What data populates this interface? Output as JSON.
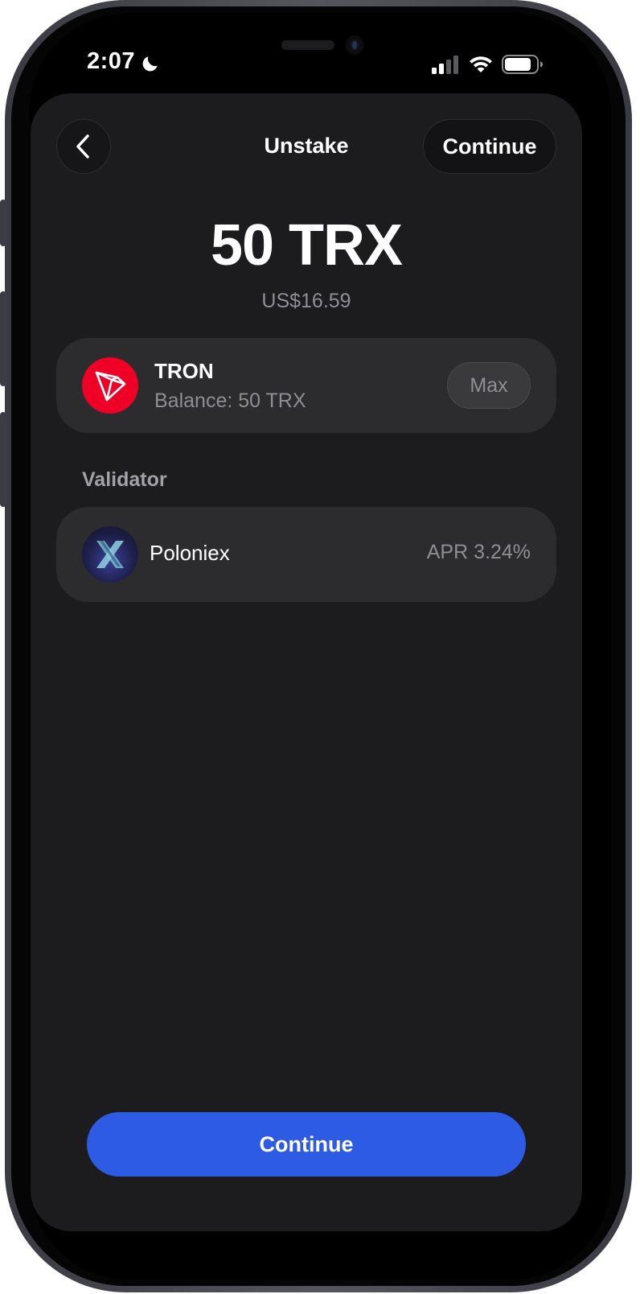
{
  "status_bar": {
    "time": "2:07",
    "icons": [
      "moon-icon",
      "cellular-signal-icon",
      "wifi-icon",
      "battery-icon"
    ]
  },
  "header": {
    "title": "Unstake",
    "back_icon": "chevron-left-icon",
    "continue_label": "Continue"
  },
  "amount": {
    "value": "50 TRX",
    "fiat": "US$16.59"
  },
  "token": {
    "icon": "tron-logo-icon",
    "name": "TRON",
    "balance": "Balance: 50 TRX",
    "max_label": "Max"
  },
  "validator": {
    "section_label": "Validator",
    "icon": "poloniex-logo-icon",
    "name": "Poloniex",
    "apr": "APR 3.24%"
  },
  "footer": {
    "continue_label": "Continue"
  },
  "colors": {
    "background": "#000000",
    "sheet": "#1c1c1e",
    "card": "#2c2c2e",
    "primary": "#2e5be3",
    "tron_red": "#ef0027",
    "secondary_text": "#8e8e93"
  }
}
